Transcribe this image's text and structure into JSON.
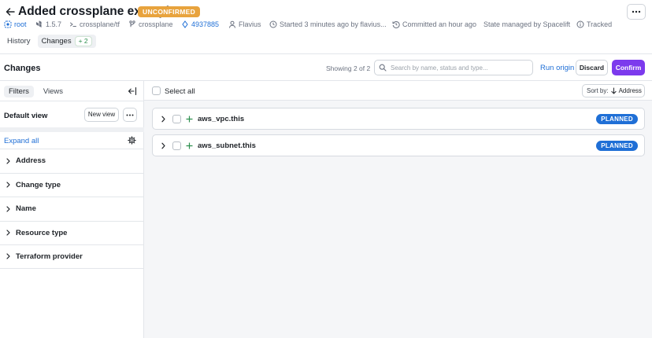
{
  "header": {
    "title": "Added crossplane example",
    "status_badge": "UNCONFIRMED"
  },
  "meta": {
    "stack": "root",
    "version": "1.5.7",
    "project_root": "crossplane/tf",
    "branch": "crossplane",
    "commit": "4937885",
    "author": "Flavius",
    "started": "Started 3 minutes ago by flavius...",
    "committed": "Committed an hour ago",
    "state": "State managed by Spacelift",
    "tracked": "Tracked"
  },
  "tabs": {
    "history": "History",
    "changes": "Changes",
    "changes_count": "+ 2"
  },
  "toolbar": {
    "heading": "Changes",
    "showing": "Showing 2 of 2",
    "search_placeholder": "Search by name, status and type...",
    "run_origin": "Run origin",
    "discard": "Discard",
    "confirm": "Confirm"
  },
  "sidebar": {
    "tab_filters": "Filters",
    "tab_views": "Views",
    "default_view": "Default view",
    "new_view": "New view",
    "expand_all": "Expand all",
    "filters": [
      "Address",
      "Change type",
      "Name",
      "Resource type",
      "Terraform provider"
    ]
  },
  "list": {
    "select_all": "Select all",
    "sort_label": "Sort by:",
    "sort_value": "Address",
    "rows": [
      {
        "address": "aws_vpc.this",
        "status": "PLANNED"
      },
      {
        "address": "aws_subnet.this",
        "status": "PLANNED"
      }
    ]
  },
  "colors": {
    "accent_purple": "#7c3aed",
    "link_blue": "#1f6fd6",
    "unconfirmed_orange": "#e8a33d",
    "planned_blue": "#1f6fd6",
    "add_green": "#2d8f4e"
  },
  "icons": [
    "back-arrow-icon",
    "stack-icon",
    "branch-icon",
    "terminal-icon",
    "commit-icon",
    "user-icon",
    "clock-icon",
    "history-icon",
    "info-icon",
    "search-icon",
    "collapse-sidebar-icon",
    "gear-icon",
    "chevron-right-icon",
    "plus-icon",
    "arrow-down-icon",
    "more-icon"
  ]
}
